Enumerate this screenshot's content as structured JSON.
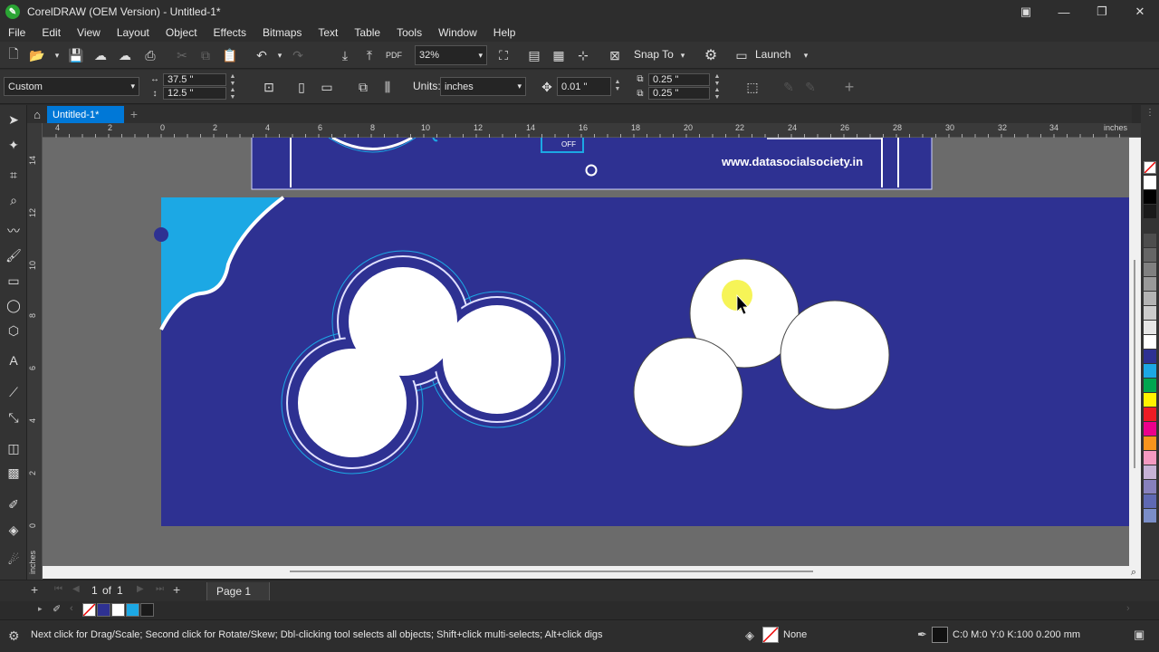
{
  "window": {
    "title": "CorelDRAW (OEM Version) - Untitled-1*",
    "app_icon": "coreldraw-logo-icon"
  },
  "menu": [
    "File",
    "Edit",
    "View",
    "Layout",
    "Object",
    "Effects",
    "Bitmaps",
    "Text",
    "Table",
    "Tools",
    "Window",
    "Help"
  ],
  "toolbar": {
    "zoom": "32%",
    "snap_to": "Snap To",
    "launch": "Launch"
  },
  "property_bar": {
    "page_preset": "Custom",
    "width": "37.5 \"",
    "height": "12.5 \"",
    "units_label": "Units:",
    "units_value": "inches",
    "nudge": "0.01 \"",
    "dup_x": "0.25 \"",
    "dup_y": "0.25 \""
  },
  "document_tab": "Untitled-1*",
  "rulers": {
    "units": "inches",
    "h_ticks": [
      "4",
      "2",
      "0",
      "2",
      "4",
      "6",
      "8",
      "10",
      "12",
      "14",
      "16",
      "18",
      "20",
      "22",
      "24",
      "26",
      "28",
      "30",
      "32",
      "34"
    ],
    "v_ticks": [
      "14",
      "12",
      "10",
      "8",
      "6",
      "4",
      "2",
      "0"
    ],
    "v_unit": "inches"
  },
  "canvas": {
    "upper_banner_url": "www.datasocialsociety.in",
    "upper_banner_badge": "OFF",
    "page_color": "#2e3192",
    "accent_color": "#1ca8e4"
  },
  "page_nav": {
    "current": "1",
    "of_label": "of",
    "total": "1",
    "page_tab": "Page 1"
  },
  "status": {
    "hint": "Next click for Drag/Scale; Second click for Rotate/Skew; Dbl-clicking tool selects all objects; Shift+click multi-selects; Alt+click digs",
    "fill_label": "None",
    "outline_info": "C:0 M:0 Y:0 K:100  0.200 mm"
  },
  "palette_colors": [
    "#ffffff",
    "#000000",
    "#1a1a1a",
    "#333333",
    "#4d4d4d",
    "#666666",
    "#808080",
    "#999999",
    "#b3b3b3",
    "#cccccc",
    "#e6e6e6",
    "#ffffff",
    "#2e3192",
    "#1ca8e4",
    "#00a650",
    "#fff200",
    "#ed1c24",
    "#ec008c",
    "#f7941d",
    "#f49ac1",
    "#c7b2d6",
    "#8781bd",
    "#5f69b3",
    "#7b8ec8"
  ],
  "doc_palette_colors": [
    "#ffffff",
    "#2e3192",
    "#ffffff",
    "#1ca8e4",
    "#1a1a1a"
  ]
}
